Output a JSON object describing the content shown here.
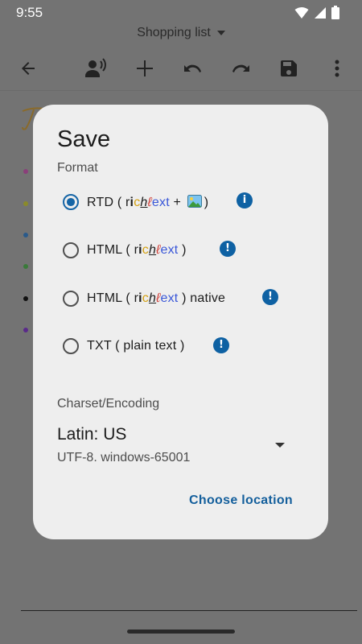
{
  "status": {
    "time": "9:55"
  },
  "app": {
    "title": "Shopping list"
  },
  "toolbar": {
    "icons": [
      "back-arrow-icon",
      "voice-icon",
      "add-icon",
      "undo-icon",
      "redo-icon",
      "save-icon",
      "more-vert-icon"
    ]
  },
  "dialog": {
    "title": "Save",
    "format_label": "Format",
    "options": [
      {
        "prefix": "RTD ( ",
        "suffix": ")",
        "selected": true,
        "badge": "i"
      },
      {
        "prefix": "HTML ( ",
        "suffix": " )",
        "selected": false,
        "badge": "!"
      },
      {
        "prefix": "HTML ( ",
        "suffix": " ) native",
        "selected": false,
        "badge": "!"
      },
      {
        "text": "TXT ( plain text )",
        "selected": false,
        "badge": "!"
      }
    ],
    "rich_text": {
      "r": "r",
      "i": "i",
      "c": "c",
      "h": "h",
      "t": "ℓ",
      "e": "e",
      "x": "x",
      "t2": "t",
      "plus": " + "
    },
    "charset_label": "Charset/Encoding",
    "charset_value": "Latin: US",
    "charset_sub": "UTF-8. windows-65001",
    "choose_location": "Choose location"
  },
  "colors": {
    "accent": "#1565a6",
    "link": "#145f9c",
    "badge": "#0e61a3",
    "dialog_bg": "#eeeeee",
    "scrim": "#737373"
  }
}
